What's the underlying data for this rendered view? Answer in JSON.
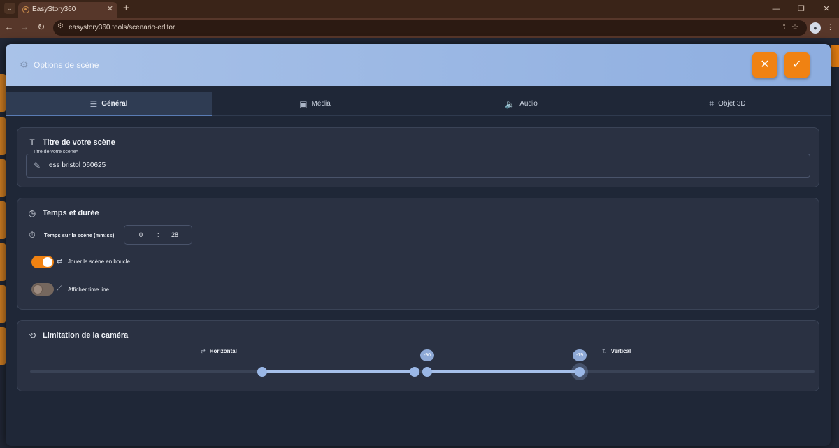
{
  "browser": {
    "tab_title": "EasyStory360",
    "url": "easystory360.tools/scenario-editor"
  },
  "modal": {
    "title": "Options de scène",
    "tabs": [
      {
        "label": "Général",
        "icon": "sliders-icon"
      },
      {
        "label": "Média",
        "icon": "image-icon"
      },
      {
        "label": "Audio",
        "icon": "speaker-icon"
      },
      {
        "label": "Objet 3D",
        "icon": "cube-scan-icon"
      }
    ],
    "active_tab": 0,
    "accent_color": "#f08212"
  },
  "title_section": {
    "heading": "Titre de votre scène",
    "field_label": "Titre de votre scène*",
    "field_value": "ess bristol 060625"
  },
  "time_section": {
    "heading": "Temps et durée",
    "time_label": "Temps sur la scène (mm:ss)",
    "minutes": "0",
    "separator": ":",
    "seconds": "28",
    "loop_label": "Jouer la scène en boucle",
    "loop_on": true,
    "timeline_label": "Afficher time line",
    "timeline_on": false
  },
  "camera_section": {
    "heading": "Limitation de la caméra",
    "horizontal_label": "Horizontal",
    "vertical_label": "Vertical",
    "horizontal_value": "-90",
    "vertical_value": "-19"
  }
}
